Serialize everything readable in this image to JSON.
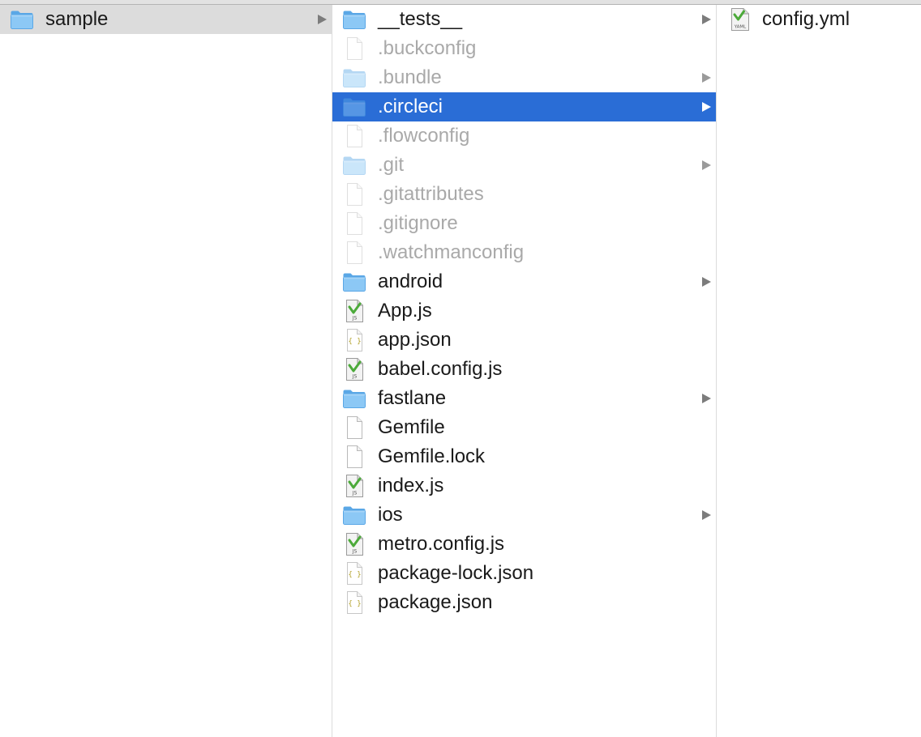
{
  "colors": {
    "selection_active": "#2a6dd6",
    "selection_inactive": "#dcdcdc",
    "hidden_text": "#a9a9a9",
    "folder_blue": "#7fc1f3"
  },
  "columns": [
    {
      "items": [
        {
          "name": "sample",
          "kind": "folder",
          "icon": "folder-icon",
          "hidden": false,
          "has_children": true,
          "state": "selected-inactive"
        }
      ]
    },
    {
      "items": [
        {
          "name": "__tests__",
          "kind": "folder",
          "icon": "folder-icon",
          "hidden": false,
          "has_children": true
        },
        {
          "name": ".buckconfig",
          "kind": "file",
          "icon": "document-icon",
          "hidden": true,
          "has_children": false
        },
        {
          "name": ".bundle",
          "kind": "folder",
          "icon": "folder-icon",
          "hidden": true,
          "has_children": true
        },
        {
          "name": ".circleci",
          "kind": "folder",
          "icon": "folder-icon",
          "hidden": true,
          "has_children": true,
          "state": "selected-active"
        },
        {
          "name": ".flowconfig",
          "kind": "file",
          "icon": "document-icon",
          "hidden": true,
          "has_children": false
        },
        {
          "name": ".git",
          "kind": "folder",
          "icon": "folder-icon",
          "hidden": true,
          "has_children": true
        },
        {
          "name": ".gitattributes",
          "kind": "file",
          "icon": "document-icon",
          "hidden": true,
          "has_children": false
        },
        {
          "name": ".gitignore",
          "kind": "file",
          "icon": "document-icon",
          "hidden": true,
          "has_children": false
        },
        {
          "name": ".watchmanconfig",
          "kind": "file",
          "icon": "document-icon",
          "hidden": true,
          "has_children": false
        },
        {
          "name": "android",
          "kind": "folder",
          "icon": "folder-icon",
          "hidden": false,
          "has_children": true
        },
        {
          "name": "App.js",
          "kind": "js",
          "icon": "js-file-icon",
          "icon_text": "JS",
          "hidden": false,
          "has_children": false
        },
        {
          "name": "app.json",
          "kind": "json",
          "icon": "json-file-icon",
          "icon_text": "{ }",
          "hidden": false,
          "has_children": false
        },
        {
          "name": "babel.config.js",
          "kind": "js",
          "icon": "js-file-icon",
          "icon_text": "JS",
          "hidden": false,
          "has_children": false
        },
        {
          "name": "fastlane",
          "kind": "folder",
          "icon": "folder-icon",
          "hidden": false,
          "has_children": true
        },
        {
          "name": "Gemfile",
          "kind": "file",
          "icon": "document-icon",
          "hidden": false,
          "has_children": false
        },
        {
          "name": "Gemfile.lock",
          "kind": "file",
          "icon": "document-icon",
          "hidden": false,
          "has_children": false
        },
        {
          "name": "index.js",
          "kind": "js",
          "icon": "js-file-icon",
          "icon_text": "JS",
          "hidden": false,
          "has_children": false
        },
        {
          "name": "ios",
          "kind": "folder",
          "icon": "folder-icon",
          "hidden": false,
          "has_children": true
        },
        {
          "name": "metro.config.js",
          "kind": "js",
          "icon": "js-file-icon",
          "icon_text": "JS",
          "hidden": false,
          "has_children": false
        },
        {
          "name": "package-lock.json",
          "kind": "json",
          "icon": "json-file-icon",
          "icon_text": "{ }",
          "hidden": false,
          "has_children": false
        },
        {
          "name": "package.json",
          "kind": "json",
          "icon": "json-file-icon",
          "icon_text": "{ }",
          "hidden": false,
          "has_children": false
        }
      ]
    },
    {
      "items": [
        {
          "name": "config.yml",
          "kind": "yaml",
          "icon": "yaml-file-icon",
          "icon_text": "YAML",
          "hidden": false,
          "has_children": false
        }
      ]
    }
  ]
}
